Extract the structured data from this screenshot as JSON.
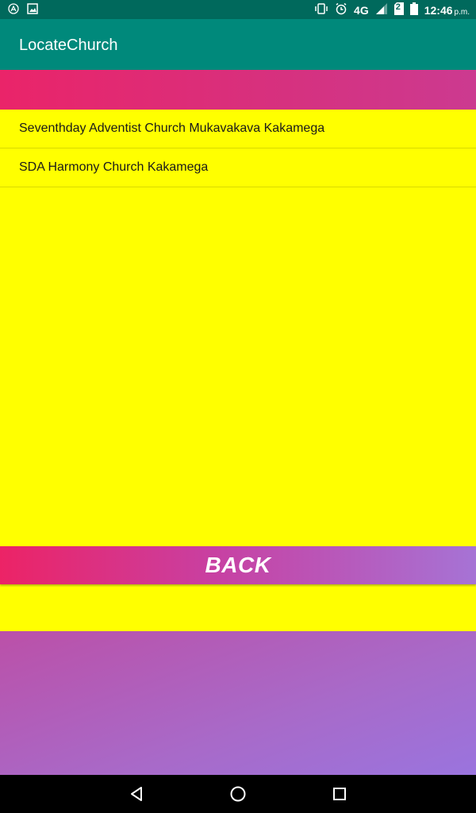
{
  "status_bar": {
    "network": "4G",
    "sim_badge": "2",
    "time": "12:46",
    "ampm": "p.m."
  },
  "app_bar": {
    "title": "LocateChurch"
  },
  "churches": [
    {
      "name": "Seventhday Adventist Church Mukavakava Kakamega"
    },
    {
      "name": "SDA Harmony Church Kakamega"
    }
  ],
  "back_button": {
    "label": "BACK"
  },
  "colors": {
    "status_bar": "#00695c",
    "app_bar": "#00897b",
    "list_background": "#ffff00",
    "accent_pink": "#ea2469",
    "accent_purple": "#9a74de"
  },
  "icons": {
    "status_left": [
      "accessibility-icon",
      "image-icon"
    ],
    "status_right": [
      "vibrate-icon",
      "alarm-icon",
      "signal-icon",
      "sim-icon",
      "battery-icon"
    ],
    "nav": [
      "back-triangle-icon",
      "home-circle-icon",
      "recents-square-icon"
    ]
  }
}
